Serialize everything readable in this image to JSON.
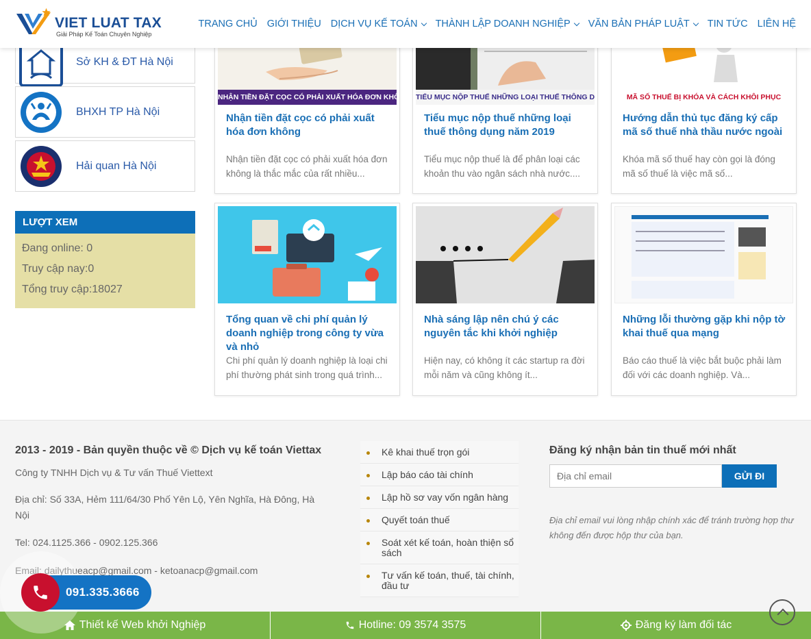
{
  "brand": {
    "name": "VIET LUAT TAX",
    "tagline": "Giải Pháp Kế Toán Chuyên Nghiệp",
    "primary_color": "#1a6fb5",
    "accent_color": "#7ab648"
  },
  "nav": {
    "items": [
      {
        "label": "TRANG CHỦ",
        "dropdown": false
      },
      {
        "label": "GIỚI THIỆU",
        "dropdown": false
      },
      {
        "label": "DỊCH VỤ KẾ TOÁN",
        "dropdown": true
      },
      {
        "label": "THÀNH LẬP DOANH NGHIỆP",
        "dropdown": true
      },
      {
        "label": "VĂN BẢN PHÁP LUẬT",
        "dropdown": true
      },
      {
        "label": "TIN TỨC",
        "dropdown": false
      },
      {
        "label": "LIÊN HỆ",
        "dropdown": false
      }
    ]
  },
  "sidebar": {
    "links": [
      {
        "label": "Sở KH & ĐT Hà Nội",
        "icon": "planning-department-emblem"
      },
      {
        "label": "BHXH TP Hà Nội",
        "icon": "social-insurance-emblem"
      },
      {
        "label": "Hải quan Hà Nội",
        "icon": "customs-emblem"
      }
    ],
    "views": {
      "heading": "LƯỢT XEM",
      "online": "Đang online: 0",
      "today": "Truy cập nay:0",
      "total": "Tổng truy cập:18027"
    }
  },
  "cards": [
    {
      "title": "Nhận tiền đặt cọc có phải xuất hóa đơn không",
      "excerpt": "Nhận tiền đặt cọc có phải xuất hóa đơn không là thắc mắc của rất nhiều...",
      "banner": "NHẬN TIỀN ĐẶT CỌC CÓ PHẢI XUẤT HÓA ĐƠN KHÔNG?"
    },
    {
      "title": "Tiểu mục nộp thuế những loại thuế thông dụng năm 2019",
      "excerpt": "Tiểu mục nộp thuế là để phân loại các khoản thu vào ngân sách nhà nước....",
      "banner": "TIỂU MỤC NỘP THUẾ NHỮNG LOẠI THUẾ THÔNG DỤNG"
    },
    {
      "title": "Hướng dẫn thủ tục đăng ký cấp mã số thuế nhà thầu nước ngoài",
      "excerpt": "Khóa mã số thuế hay còn gọi là đóng mã số thuế là việc mã số...",
      "banner": "MÃ SỐ THUẾ BỊ KHÓA VÀ CÁCH KHÔI PHỤC"
    },
    {
      "title": "Tổng quan về chi phí quản lý doanh nghiệp trong công ty vừa và nhỏ",
      "excerpt": "Chi phí quản lý doanh nghiệp là loại chi phí thường phát sinh trong quá trình...",
      "banner": ""
    },
    {
      "title": "Nhà sáng lập nên chú ý các nguyên tắc khi khởi nghiệp",
      "excerpt": "Hiện nay, có không ít các startup ra đời mỗi năm và cũng không ít...",
      "banner": ""
    },
    {
      "title": "Những lỗi thường gặp khi nộp tờ khai thuế qua mạng",
      "excerpt": "Báo cáo thuế là việc bắt buộc phải làm đối với các doanh nghiệp. Và...",
      "banner": ""
    }
  ],
  "footer": {
    "copyright": "2013 - 2019 - Bản quyền thuộc về © Dịch vụ kế toán Viettax",
    "company": "Công ty TNHH Dịch vụ & Tư vấn Thuế Viettext",
    "address": "Địa chỉ: Số 33A, Hẻm 111/64/30 Phố Yên Lộ, Yên Nghĩa, Hà Đông, Hà Nội",
    "tel": "Tel: 024.1125.366 - 0902.125.366",
    "email": "Email: dailythueacp@gmail.com - ketoanacp@gmail.com",
    "services": [
      "Kê khai thuế trọn gói",
      "Lập báo cáo tài chính",
      "Lập hồ sơ vay vốn ngân hàng",
      "Quyết toán thuế",
      "Soát xét kế toán, hoàn thiện sổ sách",
      "Tư vấn kế toán, thuế, tài chính, đầu tư"
    ],
    "newsletter": {
      "title": "Đăng ký nhận bản tin thuế mới nhất",
      "placeholder": "Địa chỉ email",
      "button": "GỬI ĐI",
      "note": "Địa chỉ email vui lòng nhập chính xác để tránh trường hợp thư không đến được hộp thư của bạn."
    }
  },
  "hotline_float": {
    "number": "091.335.3666",
    "icon": "phone-icon"
  },
  "bottom_bar": {
    "web": {
      "label": "Thiết kế Web khởi Nghiệp",
      "icon": "home-icon"
    },
    "hotline": {
      "label": "Hotline: 09 3574 3575",
      "icon": "phone-icon"
    },
    "partner": {
      "label": "Đăng ký làm đối tác",
      "icon": "gear-icon"
    }
  }
}
